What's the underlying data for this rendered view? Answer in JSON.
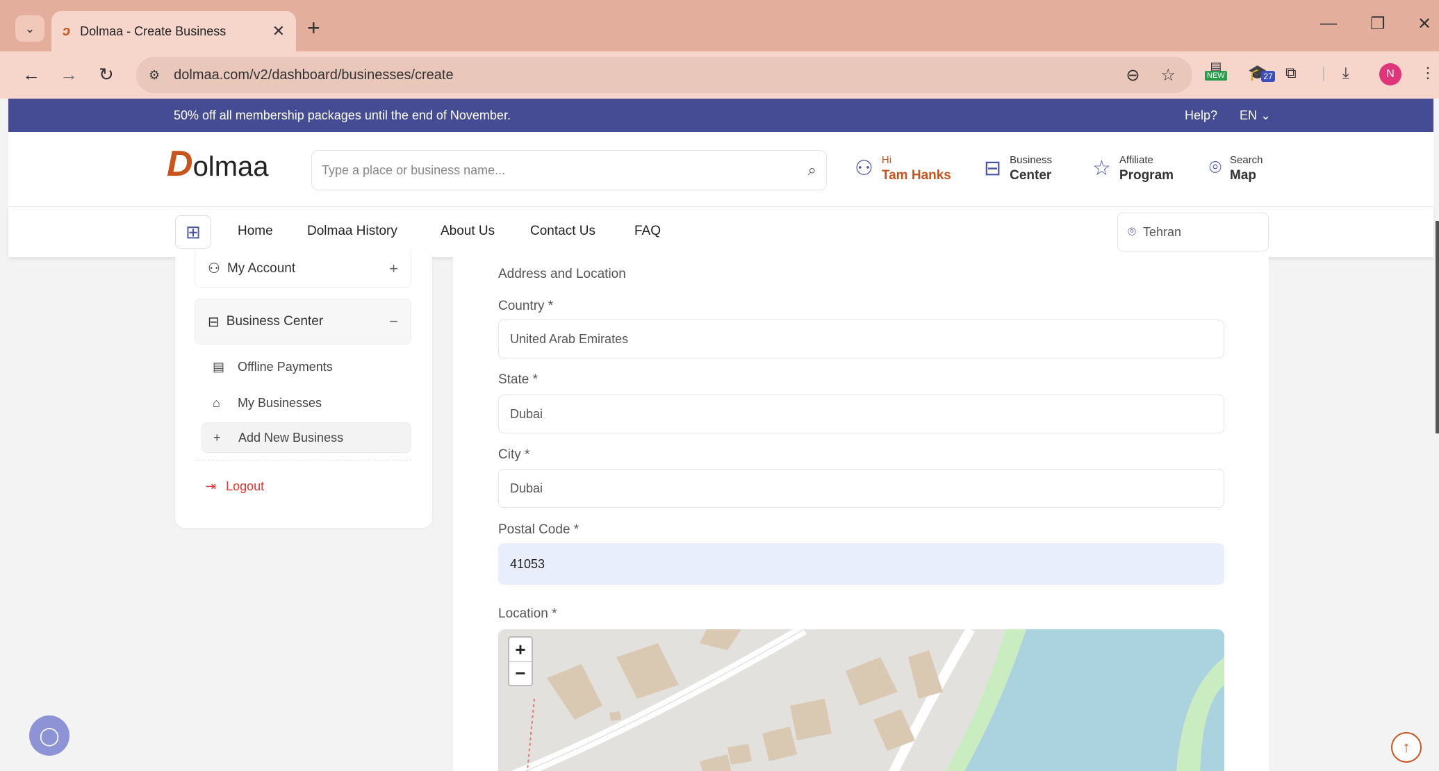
{
  "browser": {
    "tab_title": "Dolmaa - Create Business",
    "url": "dolmaa.com/v2/dashboard/businesses/create",
    "ext_new_label": "NEW",
    "ext_badge_count": "27",
    "profile_initial": "N"
  },
  "promo": {
    "message": "50% off all membership packages until the end of November.",
    "help": "Help?",
    "language": "EN"
  },
  "header": {
    "logo_text": "olmaa",
    "logo_letter": "D",
    "search_placeholder": "Type a place or business name...",
    "user": {
      "greeting": "Hi",
      "name": "Tam Hanks"
    },
    "business_center": {
      "line1": "Business",
      "line2": "Center"
    },
    "affiliate": {
      "line1": "Affiliate",
      "line2": "Program"
    },
    "search_map": {
      "line1": "Search",
      "line2": "Map"
    }
  },
  "nav": {
    "links": [
      "Home",
      "Dolmaa History",
      "About Us",
      "Contact Us",
      "FAQ"
    ],
    "location": "Tehran"
  },
  "sidebar": {
    "my_account": "My Account",
    "business_center": "Business Center",
    "items": [
      "Offline Payments",
      "My Businesses",
      "Add New Business"
    ],
    "logout": "Logout"
  },
  "form": {
    "section_title": "Address and Location",
    "country": {
      "label": "Country *",
      "value": "United Arab Emirates"
    },
    "state": {
      "label": "State *",
      "value": "Dubai"
    },
    "city": {
      "label": "City *",
      "value": "Dubai"
    },
    "postal_code": {
      "label": "Postal Code *",
      "value": "41053"
    },
    "location": {
      "label": "Location *"
    }
  },
  "colors": {
    "accent": "#464c94",
    "brand_orange": "#c8541c",
    "logout_red": "#e5322d"
  }
}
